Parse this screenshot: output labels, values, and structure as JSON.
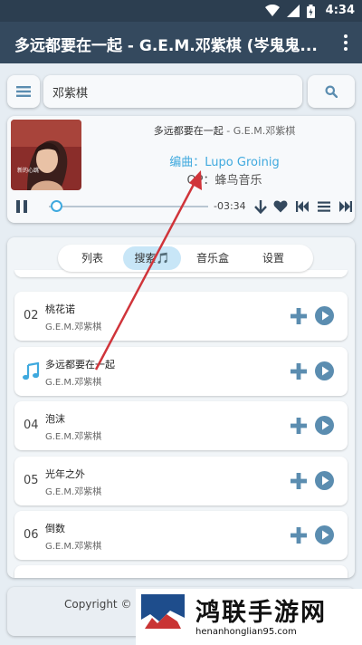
{
  "status_bar": {
    "time": "4:34"
  },
  "app_bar": {
    "title": "多远都要在一起 - G.E.M.邓紫棋 (岑鬼鬼..."
  },
  "search": {
    "value": "邓紫棋"
  },
  "player": {
    "title": "多远都要在一起",
    "artist": " - G.E.M.邓紫棋",
    "arranger": "编曲：Lupo Groinig",
    "op": "OP：蜂鸟音乐",
    "remaining": "-03:34",
    "progress_fraction": 0.05
  },
  "tabs": [
    {
      "label": "列表"
    },
    {
      "label": "搜索🎵"
    },
    {
      "label": "音乐盒"
    },
    {
      "label": "设置"
    }
  ],
  "songs": [
    {
      "num": "02",
      "title": "桃花诺",
      "artist": "G.E.M.邓紫棋"
    },
    {
      "num": "",
      "title": "多远都要在一起",
      "artist": "G.E.M.邓紫棋"
    },
    {
      "num": "04",
      "title": "泡沫",
      "artist": "G.E.M.邓紫棋"
    },
    {
      "num": "05",
      "title": "光年之外",
      "artist": "G.E.M.邓紫棋"
    },
    {
      "num": "06",
      "title": "倒数",
      "artist": "G.E.M.邓紫棋"
    }
  ],
  "footer": {
    "copyright": "Copyright © 20"
  },
  "watermark": {
    "name": "鸿联手游网",
    "url": "henanhonglian95.com"
  },
  "colors": {
    "accent": "#3fa9de",
    "appbar": "#34495e",
    "statusbar": "#2c3e50",
    "icon": "#5b8db0",
    "annotation_arrow": "#d0343a"
  }
}
